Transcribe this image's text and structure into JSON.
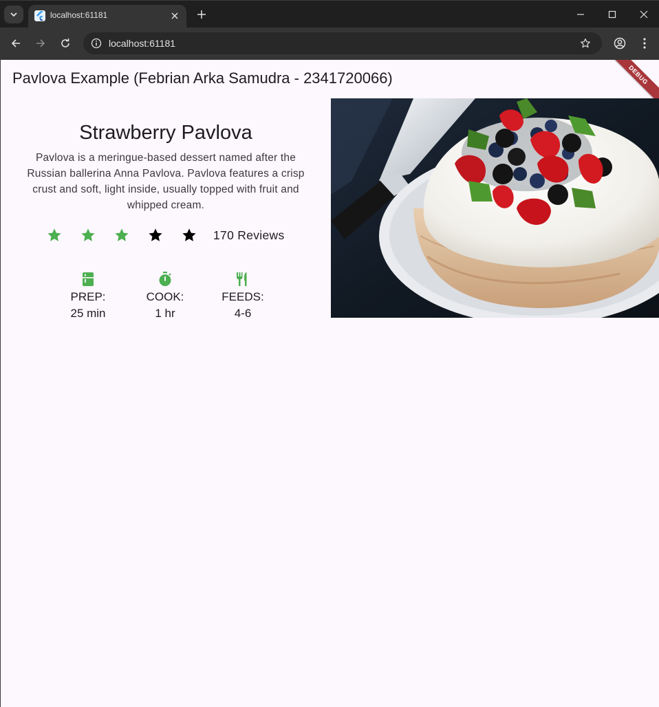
{
  "browser": {
    "tab_title": "localhost:61181",
    "url": "localhost:61181"
  },
  "app": {
    "title": "Pavlova Example (Febrian Arka Samudra - 2341720066)",
    "debug_banner": "DEBUG"
  },
  "recipe": {
    "title": "Strawberry Pavlova",
    "description": "Pavlova is a meringue-based dessert named after the Russian ballerina Anna Pavlova. Pavlova features a crisp crust and soft, light inside, usually topped with fruit and whipped cream.",
    "rating": {
      "stars_filled": 3,
      "stars_total": 5,
      "reviews_label": "170 Reviews",
      "filled_color": "#4caf50",
      "empty_color": "#000000"
    },
    "info": [
      {
        "icon": "kitchen-icon",
        "label": "PREP:",
        "value": "25 min"
      },
      {
        "icon": "timer-icon",
        "label": "COOK:",
        "value": "1 hr"
      },
      {
        "icon": "restaurant-icon",
        "label": "FEEDS:",
        "value": "4-6"
      }
    ],
    "accent_color": "#4caf50"
  }
}
